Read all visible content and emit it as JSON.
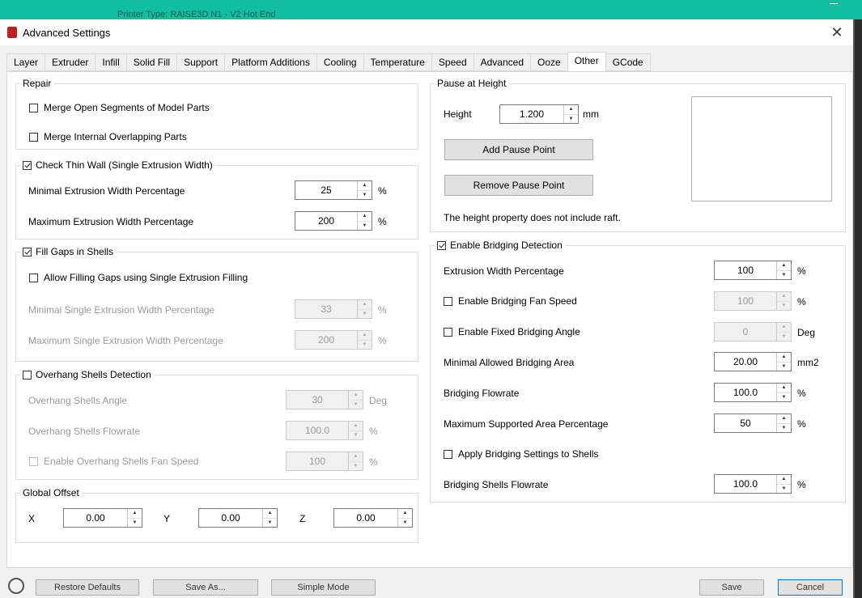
{
  "background_window": {
    "text": "Printer Type:      RAISE3D N1 - V2 Hot End"
  },
  "dialog": {
    "title": "Advanced Settings"
  },
  "tabs": [
    {
      "label": "Layer"
    },
    {
      "label": "Extruder"
    },
    {
      "label": "Infill"
    },
    {
      "label": "Solid Fill"
    },
    {
      "label": "Support"
    },
    {
      "label": "Platform Additions"
    },
    {
      "label": "Cooling"
    },
    {
      "label": "Temperature"
    },
    {
      "label": "Speed"
    },
    {
      "label": "Advanced"
    },
    {
      "label": "Ooze"
    },
    {
      "label": "Other",
      "active": true
    },
    {
      "label": "GCode"
    }
  ],
  "repair": {
    "title": "Repair",
    "merge_open": {
      "label": "Merge Open Segments of Model Parts",
      "checked": false
    },
    "merge_internal": {
      "label": "Merge Internal Overlapping Parts",
      "checked": false
    }
  },
  "thin_wall": {
    "title": "Check Thin Wall (Single Extrusion Width)",
    "checked": true,
    "min_label": "Minimal Extrusion Width Percentage",
    "min_value": "25",
    "min_unit": "%",
    "max_label": "Maximum Extrusion Width Percentage",
    "max_value": "200",
    "max_unit": "%"
  },
  "fill_gaps": {
    "title": "Fill Gaps in Shells",
    "checked": true,
    "allow_label": "Allow Filling Gaps using Single Extrusion Filling",
    "allow_checked": false,
    "min_label": "Minimal Single Extrusion Width Percentage",
    "min_value": "33",
    "min_unit": "%",
    "max_label": "Maximum Single Extrusion Width Percentage",
    "max_value": "200",
    "max_unit": "%"
  },
  "overhang": {
    "title": "Overhang Shells Detection",
    "checked": false,
    "angle_label": "Overhang Shells Angle",
    "angle_value": "30",
    "angle_unit": "Deg",
    "flow_label": "Overhang Shells Flowrate",
    "flow_value": "100.0",
    "flow_unit": "%",
    "fan_label": "Enable Overhang Shells Fan Speed",
    "fan_checked": false,
    "fan_value": "100",
    "fan_unit": "%"
  },
  "global_offset": {
    "title": "Global Offset",
    "x_label": "X",
    "x_value": "0.00",
    "y_label": "Y",
    "y_value": "0.00",
    "z_label": "Z",
    "z_value": "0.00"
  },
  "pause": {
    "title": "Pause at Height",
    "height_label": "Height",
    "height_value": "1.200",
    "height_unit": "mm",
    "add_button": "Add Pause Point",
    "remove_button": "Remove Pause Point",
    "note": "The height property does not include raft."
  },
  "bridging": {
    "title": "Enable Bridging Detection",
    "checked": true,
    "width_label": "Extrusion Width Percentage",
    "width_value": "100",
    "width_unit": "%",
    "fan_label": "Enable Bridging Fan Speed",
    "fan_checked": false,
    "fan_value": "100",
    "fan_unit": "%",
    "angle_label": "Enable Fixed Bridging Angle",
    "angle_checked": false,
    "angle_value": "0",
    "angle_unit": "Deg",
    "area_label": "Minimal Allowed Bridging Area",
    "area_value": "20.00",
    "area_unit": "mm2",
    "flow_label": "Bridging Flowrate",
    "flow_value": "100.0",
    "flow_unit": "%",
    "max_area_label": "Maximum Supported Area Percentage",
    "max_area_value": "50",
    "max_area_unit": "%",
    "apply_label": "Apply Bridging Settings to Shells",
    "apply_checked": false,
    "shells_flow_label": "Bridging Shells Flowrate",
    "shells_flow_value": "100.0",
    "shells_flow_unit": "%"
  },
  "footer": {
    "restore": "Restore Defaults",
    "save_as": "Save As...",
    "simple": "Simple Mode",
    "save": "Save",
    "cancel": "Cancel"
  }
}
